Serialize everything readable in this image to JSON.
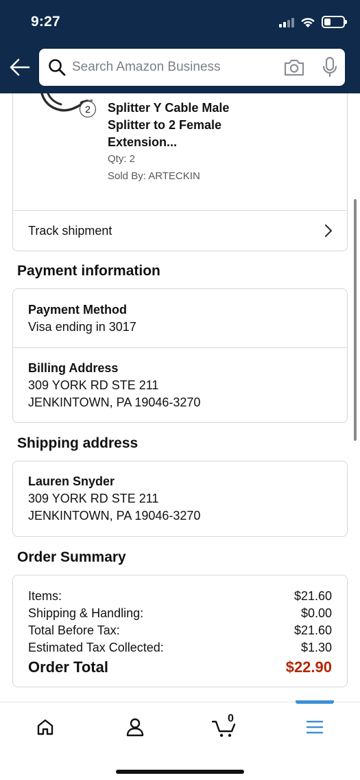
{
  "status_bar": {
    "time": "9:27"
  },
  "search": {
    "placeholder": "Search Amazon Business"
  },
  "product": {
    "title": "Splitter Y Cable Male Splitter to 2 Female Extension...",
    "quantity_badge": "2",
    "qty": "Qty: 2",
    "sold_by": "Sold By: ARTECKIN"
  },
  "track": {
    "label": "Track shipment"
  },
  "payment": {
    "heading": "Payment information",
    "method_label": "Payment Method",
    "method_value": "Visa ending in 3017",
    "billing_label": "Billing Address",
    "billing_line1": "309 YORK RD STE 211",
    "billing_line2": "JENKINTOWN, PA 19046-3270"
  },
  "shipping": {
    "heading": "Shipping address",
    "name": "Lauren Snyder",
    "line1": "309 YORK RD STE 211",
    "line2": "JENKINTOWN, PA 19046-3270"
  },
  "summary": {
    "heading": "Order Summary",
    "rows": [
      {
        "label": "Items:",
        "value": "$21.60"
      },
      {
        "label": "Shipping & Handling:",
        "value": "$0.00"
      },
      {
        "label": "Total Before Tax:",
        "value": "$21.60"
      },
      {
        "label": "Estimated Tax Collected:",
        "value": "$1.30"
      }
    ],
    "total_label": "Order Total",
    "total_value": "$22.90"
  },
  "bottom_nav": {
    "cart_count": "0",
    "items": [
      "home-icon",
      "account-icon",
      "cart-icon",
      "menu-icon"
    ],
    "active": "menu-icon"
  },
  "colors": {
    "header_bg": "#0f2a4a",
    "order_total": "#b12704",
    "active_tab": "#3d8fd6"
  }
}
